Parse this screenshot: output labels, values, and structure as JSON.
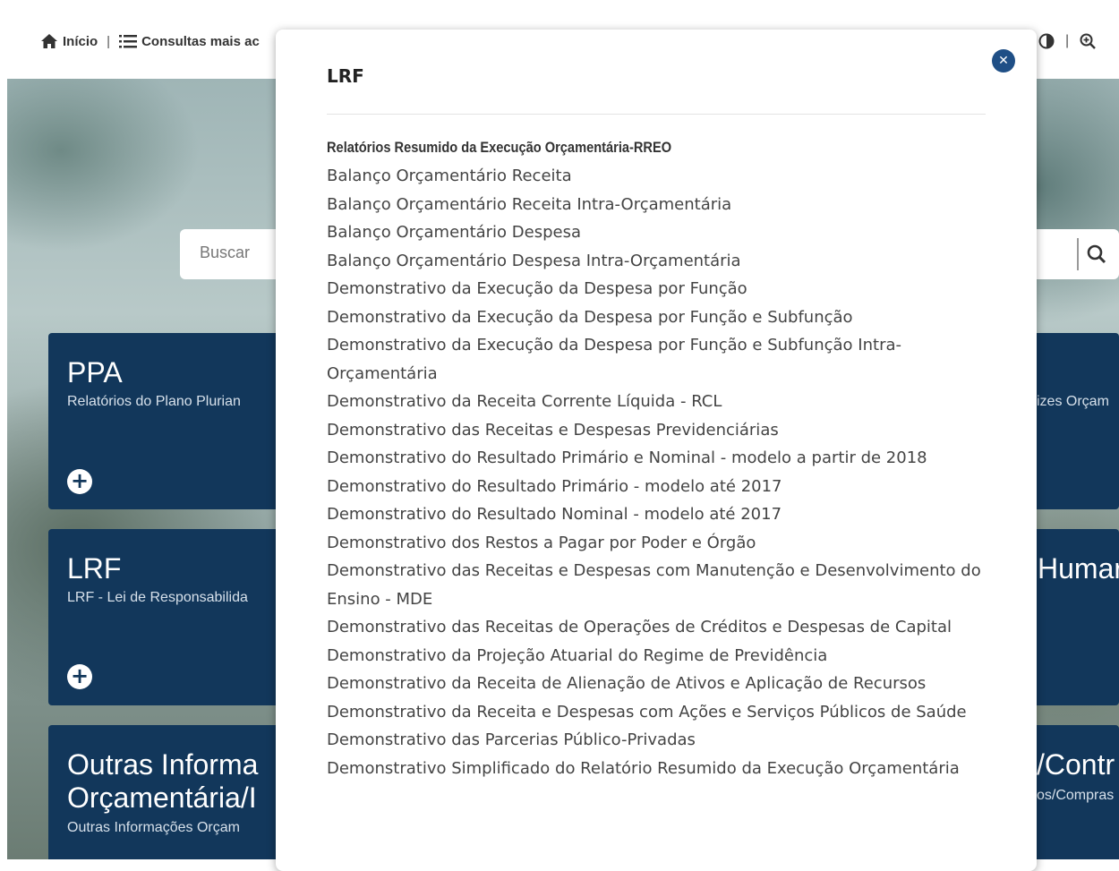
{
  "topbar": {
    "home_label": "Início",
    "separator": "|",
    "consultas_label": "Consultas mais ac",
    "right_separator": "|"
  },
  "search": {
    "placeholder": "Buscar"
  },
  "cards": {
    "ppa": {
      "title": "PPA",
      "subtitle": "Relatórios do Plano Plurian"
    },
    "lrf": {
      "title": "LRF",
      "subtitle": "LRF - Lei de Responsabilida"
    },
    "outras": {
      "title_line1": "Outras Informa",
      "title_line2": "Orçamentária/I",
      "subtitle": "Outras Informações Orçam"
    },
    "right_partial_1": {
      "subtitle": "izes Orçam"
    },
    "right_partial_2": {
      "title": "Humar"
    },
    "right_partial_3": {
      "title": "/Contr",
      "subtitle": "os/Compras"
    }
  },
  "modal": {
    "title": "LRF",
    "section_title": "Relatórios Resumido da Execução Orçamentária-RREO",
    "links": [
      "Balanço Orçamentário Receita",
      "Balanço Orçamentário Receita Intra-Orçamentária",
      "Balanço Orçamentário Despesa",
      "Balanço Orçamentário Despesa Intra-Orçamentária",
      "Demonstrativo da Execução da Despesa por Função",
      "Demonstrativo da Execução da Despesa por Função e Subfunção",
      "Demonstrativo da Execução da Despesa por Função e Subfunção Intra-Orçamentária",
      "Demonstrativo da Receita Corrente Líquida - RCL",
      "Demonstrativo das Receitas e Despesas Previdenciárias",
      "Demonstrativo do Resultado Primário e Nominal - modelo a partir de 2018",
      "Demonstrativo do Resultado Primário - modelo até 2017",
      "Demonstrativo do Resultado Nominal - modelo até 2017",
      "Demonstrativo dos Restos a Pagar por Poder e Órgão",
      "Demonstrativo das Receitas e Despesas com Manutenção e Desenvolvimento do Ensino - MDE",
      "Demonstrativo das Receitas de Operações de Créditos e Despesas de Capital",
      "Demonstrativo da Projeção Atuarial do Regime de Previdência",
      "Demonstrativo da Receita de Alienação de Ativos e Aplicação de Recursos",
      "Demonstrativo da Receita e Despesas com Ações e Serviços Públicos de Saúde",
      "Demonstrativo das Parcerias Público-Privadas",
      "Demonstrativo Simplificado do Relatório Resumido da Execução Orçamentária"
    ]
  },
  "colors": {
    "card_bg": "#12375b",
    "close_button": "#1f4f86"
  },
  "icons": [
    "home-icon",
    "list-icon",
    "contrast-icon",
    "zoom-in-icon",
    "search-icon",
    "plus-circle-icon",
    "close-icon"
  ]
}
